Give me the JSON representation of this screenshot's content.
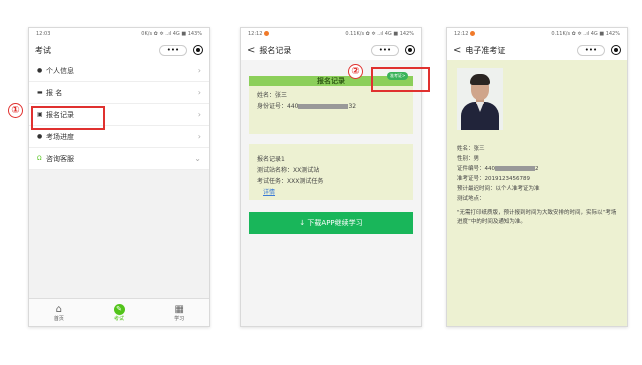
{
  "colors": {
    "accent_green": "#19b65a",
    "highlight_red": "#e0312f",
    "card_bg": "#edf1d2"
  },
  "steps": {
    "step1": "①",
    "step2": "②"
  },
  "screen1": {
    "status": {
      "time": "12:03",
      "net": "0K/s ✿ ✲ ..ıl 4G ■ 143%"
    },
    "nav": {
      "title": "考试",
      "more": "•••"
    },
    "menu": [
      {
        "icon": "person-icon",
        "label": "个人信息"
      },
      {
        "icon": "id-card-icon",
        "label": "报 名"
      },
      {
        "icon": "record-icon",
        "label": "报名记录"
      },
      {
        "icon": "progress-icon",
        "label": "考场进度"
      },
      {
        "icon": "headset-icon",
        "label": "咨询客服"
      }
    ],
    "tabs": [
      {
        "icon": "home-icon",
        "label": "首页"
      },
      {
        "icon": "exam-icon",
        "label": "考试"
      },
      {
        "icon": "study-icon",
        "label": "学习"
      }
    ]
  },
  "screen2": {
    "status": {
      "time": "12:12",
      "net": "0.11K/s ✿ ✲ ..ıl 4G ■ 142%"
    },
    "nav": {
      "back": "<",
      "title": "报名记录",
      "more": "•••"
    },
    "card1": {
      "header": "报名记录",
      "badge": "准考证>",
      "name": "姓名：张三",
      "id_prefix": "身份证号：440",
      "id_suffix": "32"
    },
    "card2": {
      "title": "报名记录1",
      "site": "测试站名称：XX测试站",
      "task": "考试任务：XXX测试任务",
      "link": "详情"
    },
    "download_button": "下载APP继续学习"
  },
  "screen3": {
    "status": {
      "time": "12:12",
      "net": "0.11K/s ✿ ✲ ..ıl 4G ■ 142%"
    },
    "nav": {
      "back": "<",
      "title": "电子准考证",
      "more": "•••"
    },
    "fields": [
      {
        "label": "姓名：张三"
      },
      {
        "label": "性别：男"
      },
      {
        "label": "证件编号：440",
        "masked": true,
        "suffix": "2"
      },
      {
        "label": "准考证号：2019123456789"
      },
      {
        "label": "预计最迟时间：以个人准考证为准"
      },
      {
        "label": "测试地点："
      }
    ],
    "notice": "\"无需打印纸质版，预计报到时间为大致安排的时间，实际以“考场进度”中的时间及通知为准。"
  }
}
